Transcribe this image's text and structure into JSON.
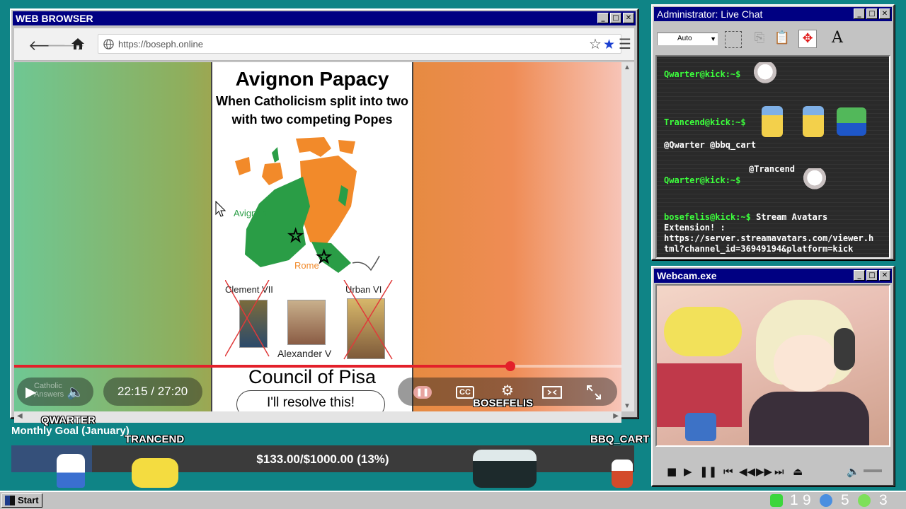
{
  "browser": {
    "title": "WEB BROWSER",
    "url": "https://boseph.online",
    "window_buttons": [
      "_",
      "□",
      "✕"
    ]
  },
  "video": {
    "slide_title": "Avignon Papacy",
    "slide_subtitle_1": "When Catholicism split into two",
    "slide_subtitle_2": "with two competing Popes",
    "map_label_avignon": "Avignon",
    "map_label_rome": "Rome",
    "pope_1": "Clement VII",
    "pope_2": "Urban VI",
    "pope_3": "Alexander V",
    "council": "Council of Pisa",
    "speech": "I'll resolve this!",
    "watermark": "Catholic Answers",
    "time": "22:15 / 27:20",
    "progress": 0.817,
    "cc_label": "CC"
  },
  "chat": {
    "title": "Administrator: Live Chat",
    "dropdown_value": "Auto",
    "messages": [
      {
        "user": "Qwarter@kick:~$",
        "text": ""
      },
      {
        "user": "Trancend@kick:~$",
        "text": ""
      },
      {
        "user": "",
        "text": "@Qwarter @bbq_cart"
      },
      {
        "user": "",
        "text": "@Trancend"
      },
      {
        "user": "Qwarter@kick:~$",
        "text": ""
      },
      {
        "user": "bosefelis@kick:~$",
        "text": "Stream Avatars"
      },
      {
        "user": "",
        "text": "Extension! :"
      },
      {
        "user": "",
        "text": "https://server.streamavatars.com/viewer.h"
      },
      {
        "user": "",
        "text": "tml?channel_id=36949194&platform=kick"
      }
    ]
  },
  "webcam": {
    "title": "Webcam.exe"
  },
  "overlay": {
    "goal_title": "Monthly Goal (January)",
    "goal_text": "$133.00/$1000.00 (13%)",
    "goal_fraction": 0.13,
    "avatars": [
      "QWARTER",
      "TRANCEND",
      "BOSEFELIS",
      "BBQ_CART"
    ]
  },
  "taskbar": {
    "start_label": "Start",
    "tray": [
      {
        "icon": "kick-icon",
        "value": "1"
      },
      {
        "icon": "nine",
        "value": "9"
      },
      {
        "icon": "moon-icon",
        "value": "5"
      },
      {
        "icon": "play-icon",
        "value": "3"
      }
    ]
  },
  "colors": {
    "desktop": "#0f8486",
    "titlebar": "#000082",
    "chat_user": "#3cff3c",
    "progress": "#e3202a",
    "goal_fill": "#35507a"
  }
}
